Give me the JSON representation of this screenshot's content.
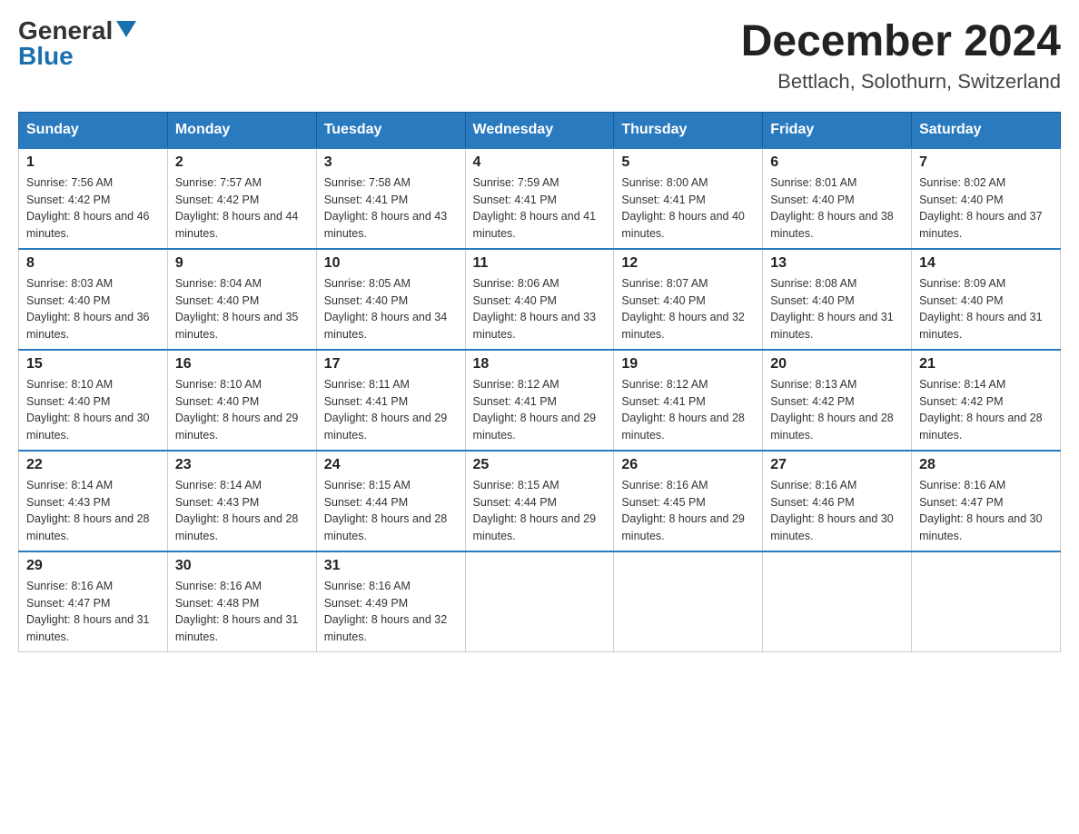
{
  "header": {
    "logo": {
      "general": "General",
      "blue": "Blue",
      "arrow": "▲"
    },
    "title": "December 2024",
    "location": "Bettlach, Solothurn, Switzerland"
  },
  "days_of_week": [
    "Sunday",
    "Monday",
    "Tuesday",
    "Wednesday",
    "Thursday",
    "Friday",
    "Saturday"
  ],
  "weeks": [
    [
      {
        "day": "1",
        "sunrise": "7:56 AM",
        "sunset": "4:42 PM",
        "daylight": "8 hours and 46 minutes."
      },
      {
        "day": "2",
        "sunrise": "7:57 AM",
        "sunset": "4:42 PM",
        "daylight": "8 hours and 44 minutes."
      },
      {
        "day": "3",
        "sunrise": "7:58 AM",
        "sunset": "4:41 PM",
        "daylight": "8 hours and 43 minutes."
      },
      {
        "day": "4",
        "sunrise": "7:59 AM",
        "sunset": "4:41 PM",
        "daylight": "8 hours and 41 minutes."
      },
      {
        "day": "5",
        "sunrise": "8:00 AM",
        "sunset": "4:41 PM",
        "daylight": "8 hours and 40 minutes."
      },
      {
        "day": "6",
        "sunrise": "8:01 AM",
        "sunset": "4:40 PM",
        "daylight": "8 hours and 38 minutes."
      },
      {
        "day": "7",
        "sunrise": "8:02 AM",
        "sunset": "4:40 PM",
        "daylight": "8 hours and 37 minutes."
      }
    ],
    [
      {
        "day": "8",
        "sunrise": "8:03 AM",
        "sunset": "4:40 PM",
        "daylight": "8 hours and 36 minutes."
      },
      {
        "day": "9",
        "sunrise": "8:04 AM",
        "sunset": "4:40 PM",
        "daylight": "8 hours and 35 minutes."
      },
      {
        "day": "10",
        "sunrise": "8:05 AM",
        "sunset": "4:40 PM",
        "daylight": "8 hours and 34 minutes."
      },
      {
        "day": "11",
        "sunrise": "8:06 AM",
        "sunset": "4:40 PM",
        "daylight": "8 hours and 33 minutes."
      },
      {
        "day": "12",
        "sunrise": "8:07 AM",
        "sunset": "4:40 PM",
        "daylight": "8 hours and 32 minutes."
      },
      {
        "day": "13",
        "sunrise": "8:08 AM",
        "sunset": "4:40 PM",
        "daylight": "8 hours and 31 minutes."
      },
      {
        "day": "14",
        "sunrise": "8:09 AM",
        "sunset": "4:40 PM",
        "daylight": "8 hours and 31 minutes."
      }
    ],
    [
      {
        "day": "15",
        "sunrise": "8:10 AM",
        "sunset": "4:40 PM",
        "daylight": "8 hours and 30 minutes."
      },
      {
        "day": "16",
        "sunrise": "8:10 AM",
        "sunset": "4:40 PM",
        "daylight": "8 hours and 29 minutes."
      },
      {
        "day": "17",
        "sunrise": "8:11 AM",
        "sunset": "4:41 PM",
        "daylight": "8 hours and 29 minutes."
      },
      {
        "day": "18",
        "sunrise": "8:12 AM",
        "sunset": "4:41 PM",
        "daylight": "8 hours and 29 minutes."
      },
      {
        "day": "19",
        "sunrise": "8:12 AM",
        "sunset": "4:41 PM",
        "daylight": "8 hours and 28 minutes."
      },
      {
        "day": "20",
        "sunrise": "8:13 AM",
        "sunset": "4:42 PM",
        "daylight": "8 hours and 28 minutes."
      },
      {
        "day": "21",
        "sunrise": "8:14 AM",
        "sunset": "4:42 PM",
        "daylight": "8 hours and 28 minutes."
      }
    ],
    [
      {
        "day": "22",
        "sunrise": "8:14 AM",
        "sunset": "4:43 PM",
        "daylight": "8 hours and 28 minutes."
      },
      {
        "day": "23",
        "sunrise": "8:14 AM",
        "sunset": "4:43 PM",
        "daylight": "8 hours and 28 minutes."
      },
      {
        "day": "24",
        "sunrise": "8:15 AM",
        "sunset": "4:44 PM",
        "daylight": "8 hours and 28 minutes."
      },
      {
        "day": "25",
        "sunrise": "8:15 AM",
        "sunset": "4:44 PM",
        "daylight": "8 hours and 29 minutes."
      },
      {
        "day": "26",
        "sunrise": "8:16 AM",
        "sunset": "4:45 PM",
        "daylight": "8 hours and 29 minutes."
      },
      {
        "day": "27",
        "sunrise": "8:16 AM",
        "sunset": "4:46 PM",
        "daylight": "8 hours and 30 minutes."
      },
      {
        "day": "28",
        "sunrise": "8:16 AM",
        "sunset": "4:47 PM",
        "daylight": "8 hours and 30 minutes."
      }
    ],
    [
      {
        "day": "29",
        "sunrise": "8:16 AM",
        "sunset": "4:47 PM",
        "daylight": "8 hours and 31 minutes."
      },
      {
        "day": "30",
        "sunrise": "8:16 AM",
        "sunset": "4:48 PM",
        "daylight": "8 hours and 31 minutes."
      },
      {
        "day": "31",
        "sunrise": "8:16 AM",
        "sunset": "4:49 PM",
        "daylight": "8 hours and 32 minutes."
      },
      null,
      null,
      null,
      null
    ]
  ]
}
